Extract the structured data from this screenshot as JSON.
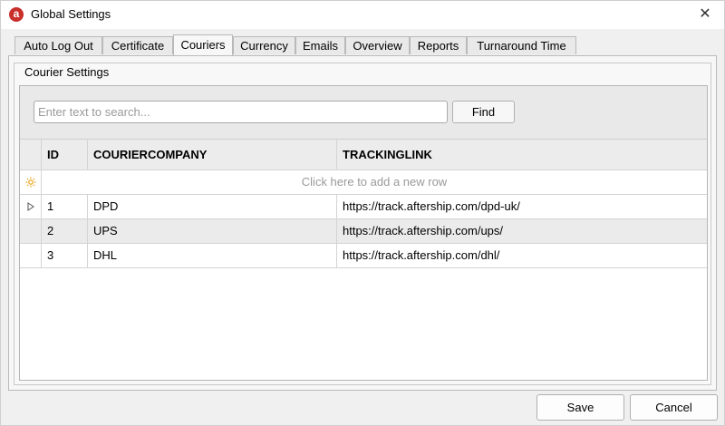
{
  "window": {
    "title": "Global Settings",
    "app_icon_letter": "a"
  },
  "tabs": [
    {
      "label": "Auto Log Out"
    },
    {
      "label": "Certificate"
    },
    {
      "label": "Couriers",
      "active": true
    },
    {
      "label": "Currency"
    },
    {
      "label": "Emails"
    },
    {
      "label": "Overview"
    },
    {
      "label": "Reports"
    },
    {
      "label": "Turnaround Time"
    }
  ],
  "group": {
    "caption": "Courier Settings"
  },
  "search": {
    "placeholder": "Enter text to search...",
    "value": "",
    "find_label": "Find"
  },
  "grid": {
    "columns": [
      "ID",
      "COURIERCOMPANY",
      "TRACKINGLINK"
    ],
    "new_row_text": "Click here to add a new row",
    "rows": [
      {
        "id": "1",
        "company": "DPD",
        "link": "https://track.aftership.com/dpd-uk/",
        "focused": true
      },
      {
        "id": "2",
        "company": "UPS",
        "link": "https://track.aftership.com/ups/"
      },
      {
        "id": "3",
        "company": "DHL",
        "link": "https://track.aftership.com/dhl/"
      }
    ]
  },
  "buttons": {
    "save": "Save",
    "cancel": "Cancel"
  },
  "colors": {
    "app_icon": "#c9302c",
    "new_row_icon": "#e8a317",
    "alt_row": "#ebebeb",
    "header_bg": "#ececec"
  },
  "icons": {
    "new_row": "sun-icon",
    "focused_row": "triangle-right-icon",
    "close": "close-icon"
  }
}
